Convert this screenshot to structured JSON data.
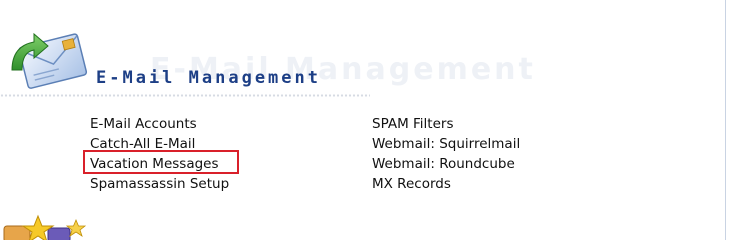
{
  "section": {
    "title": "E-Mail Management",
    "watermark": "E-Mail Management"
  },
  "links": {
    "column1": [
      "E-Mail Accounts",
      "Catch-All E-Mail",
      "Vacation Messages",
      "Spamassassin Setup"
    ],
    "column2": [
      "SPAM Filters",
      "Webmail: Squirrelmail",
      "Webmail: Roundcube",
      "MX Records"
    ]
  },
  "highlighted_item": "Vacation Messages",
  "icons": {
    "header": "email-envelope-arrow-icon",
    "next_section": "stars-icon"
  },
  "colors": {
    "title": "#1d3f86",
    "highlight_border": "#d9202a",
    "link_text": "#111111"
  }
}
